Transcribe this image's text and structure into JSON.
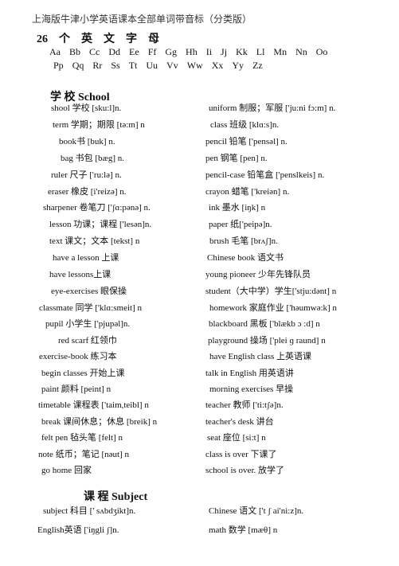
{
  "document": {
    "title": "上海版牛津小学英语课本全部单词带音标（分类版）"
  },
  "alphabet": {
    "heading": [
      "26",
      "个",
      "英",
      "文",
      "字",
      "母"
    ],
    "row1": [
      "Aa",
      "Bb",
      "Cc",
      "Dd",
      "Ee",
      "Ff",
      "Gg",
      "Hh",
      "Ii",
      "Jj",
      "Kk",
      "Ll",
      "Mn",
      "Nn",
      "Oo"
    ],
    "row2": [
      "Pp",
      "Qq",
      "Rr",
      "Ss",
      "Tt",
      "Uu",
      "Vv",
      "Ww",
      "Xx",
      "Yy",
      "Zz"
    ]
  },
  "school": {
    "heading": "学  校   School",
    "left": [
      "shool  学校 [sku:l]n.",
      "term   学期；期限  [tə:m] n",
      "book书   [buk] n.",
      "bag  书包  [bæg] n.",
      "ruler   尺子     ['ru:lə] n.",
      "eraser  橡皮    [i'reizə] n.",
      "sharpener    卷笔刀     ['ʃɑ:pənə] n.",
      "lesson 功课；课程 ['lesən]n.",
      "text  课文；文本  [tekst] n",
      "have a lesson  上课",
      "have lessons上课",
      "eye-exercises  眼保操"
    ],
    "right": [
      "uniform  制服；军服 ['ju:ni fɔ:m] n.",
      "class   班级  [klɑ:s]n.",
      "pencil  铅笔    ['pensəl] n.",
      "pen  钢笔   [pen] n.",
      "pencil-case  铅笔盒   ['penslkeis] n.",
      "crayon 蜡笔    ['kreiən] n.",
      "ink  墨水 [iŋk] n",
      "paper  纸['peipə]n.",
      "brush  毛笔    [brʌʃ]n.",
      "Chinese book  语文书",
      "young pioneer  少年先锋队员",
      "student（大中学）学生['stju:dənt] n"
    ],
    "left2": [
      "classmate 同学  ['klɑ:smeit] n",
      "pupil  小学生  ['pjupəl]n.",
      "red scarf   红领巾",
      "exercise-book  练习本",
      "begin classes   开始上课",
      "paint   颜料  [peint] n",
      "timetable  课程表    ['taim,teibl] n",
      "break  课间休息；休息  [breik] n",
      "felt pen   毡头笔 [felt] n",
      "note 纸币；笔记  [nəut] n",
      "go home  回家"
    ],
    "right2": [
      "homework  家庭作业 ['həumwə:k] n",
      "blackboard  黑板 ['blækb ɔ :d] n",
      "playground  操场 ['plei ɡ   raund] n",
      "have English class  上英语课",
      "talk in English  用英语讲",
      "morning exercises  早操",
      "teacher 教师  ['ti:tʃə]n.",
      "teacher's desk  讲台",
      "seat 座位 [si:t] n",
      "class is over 下课了",
      "school is over.  放学了"
    ]
  },
  "subject": {
    "heading": "课  程    Subject",
    "left": [
      "subject   科目   [' sʌbdʒikt]n.",
      "English英语 ['iŋgli ʃ]n."
    ],
    "right": [
      "Chinese   语文 ['t ʃ ai'ni:z]n.",
      "math   数学  [mæθ] n"
    ]
  }
}
